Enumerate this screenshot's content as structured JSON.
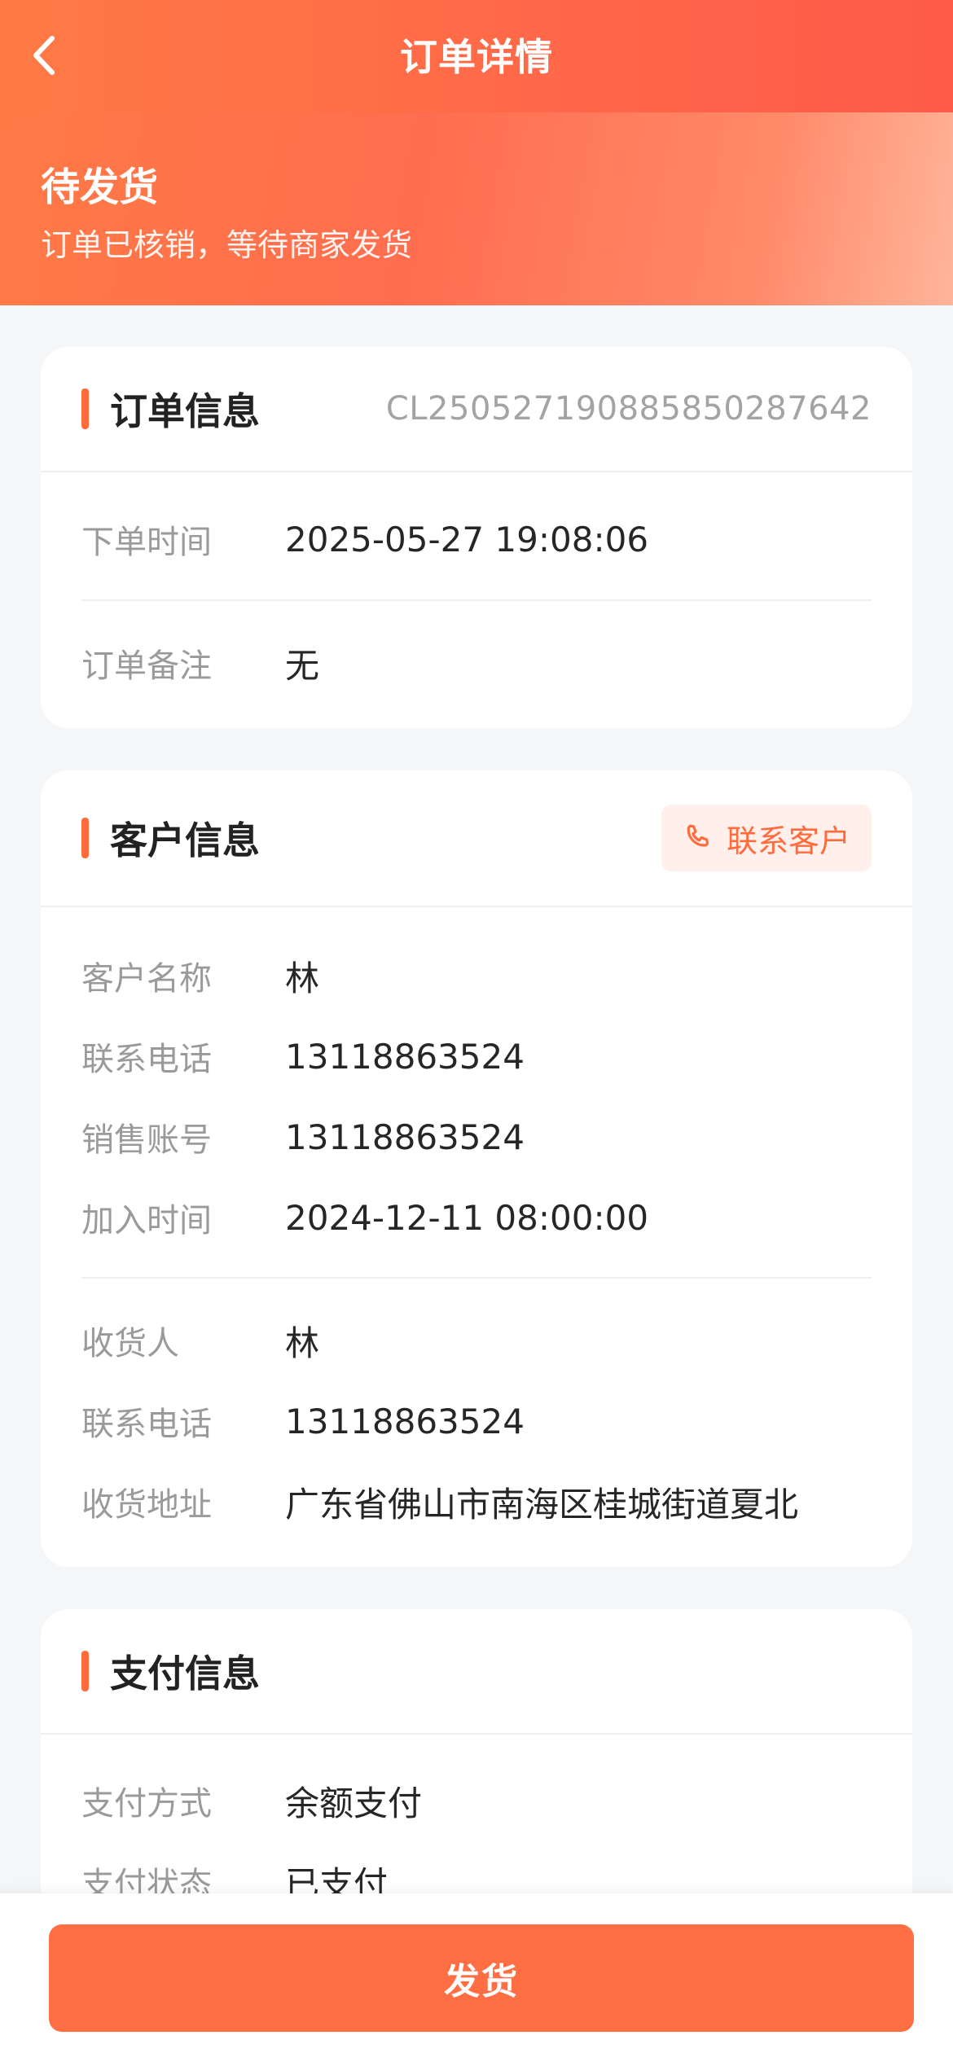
{
  "nav": {
    "title": "订单详情"
  },
  "status": {
    "title": "待发货",
    "subtitle": "订单已核销，等待商家发货"
  },
  "order_info": {
    "title": "订单信息",
    "order_no": "CL25052719088585028764​2",
    "rows": [
      {
        "label": "下单时间",
        "value": "2025-05-27 19:08:06"
      },
      {
        "label": "订单备注",
        "value": "无"
      }
    ]
  },
  "customer_info": {
    "title": "客户信息",
    "contact_label": "联系客户",
    "rows": [
      {
        "label": "客户名称",
        "value": "林"
      },
      {
        "label": "联系电话",
        "value": "13118863524"
      },
      {
        "label": "销售账号",
        "value": "13118863524"
      },
      {
        "label": "加入时间",
        "value": "2024-12-11 08:00:00"
      }
    ],
    "shipping_rows": [
      {
        "label": "收货人",
        "value": "林"
      },
      {
        "label": "联系电话",
        "value": "13118863524"
      },
      {
        "label": "收货地址",
        "value": "广东省佛山市南海区桂城街道夏北"
      }
    ]
  },
  "payment_info": {
    "title": "支付信息",
    "rows": [
      {
        "label": "支付方式",
        "value": "余额支付"
      },
      {
        "label": "支付状态",
        "value": "已支付"
      }
    ]
  },
  "footer": {
    "ship_label": "发货"
  },
  "colors": {
    "accent": "#ff6b3d",
    "header_start": "#ff7a45",
    "header_end": "#ff5a4a"
  },
  "icons": {
    "back": "chevron-left-icon",
    "phone": "phone-icon"
  }
}
